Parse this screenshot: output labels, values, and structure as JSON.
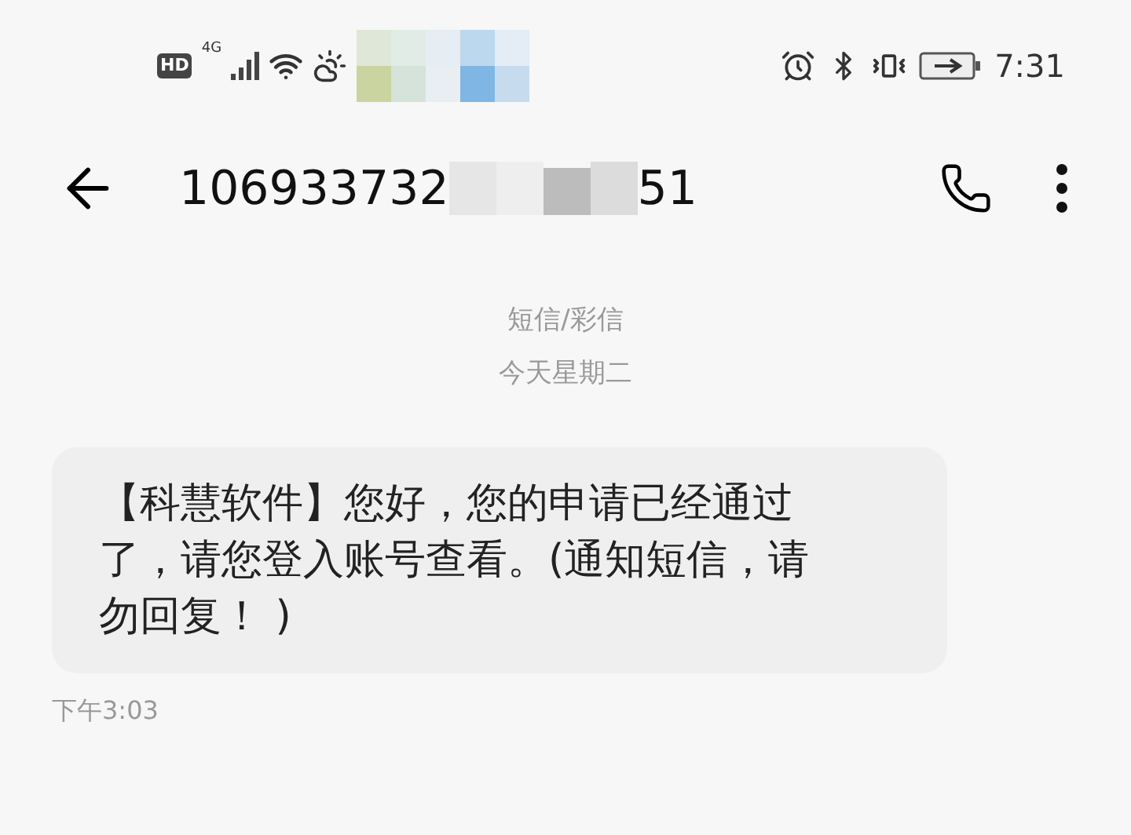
{
  "status_bar": {
    "hd": "HD",
    "network": "4G",
    "time": "7:31"
  },
  "header": {
    "number_start": "106933732",
    "number_end": "51"
  },
  "conversation": {
    "channel": "短信/彩信",
    "date": "今天星期二"
  },
  "messages": [
    {
      "text": "【科慧软件】您好，您的申请已经通过了，请您登入账号查看。(通知短信，请勿回复！ )",
      "time": "下午3:03"
    }
  ]
}
